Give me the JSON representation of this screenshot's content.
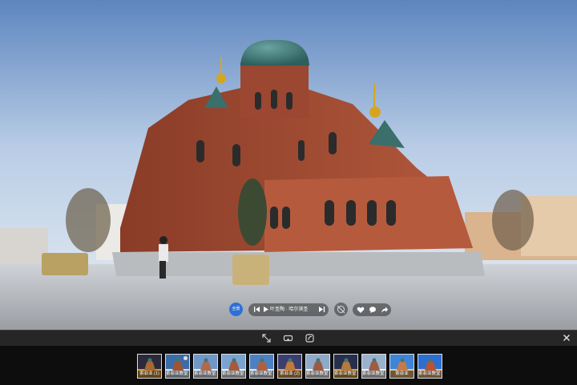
{
  "viewer": {
    "scene_image": "Saint Sophia Cathedral panorama (winter)",
    "avatar_text": "全景"
  },
  "player": {
    "title": "叶圣陶 · 哈尔滨圣"
  },
  "toolbar": {
    "icons": [
      "fullscreen-icon",
      "vr-glasses-icon",
      "gyroscope-icon"
    ],
    "close_icon": "close-icon"
  },
  "thumbnails": [
    {
      "label": "索菲亚 (1)",
      "active": false
    },
    {
      "label": "索菲亚教堂 (2)",
      "active": true
    },
    {
      "label": "索菲亚教堂 (3)",
      "active": false
    },
    {
      "label": "索菲亚教堂 (4)",
      "active": false
    },
    {
      "label": "索菲亚教堂 (5)",
      "active": false
    },
    {
      "label": "索菲亚 (2)",
      "active": false
    },
    {
      "label": "索菲亚教堂 (6)",
      "active": false
    },
    {
      "label": "索菲亚教堂 (7)",
      "active": false
    },
    {
      "label": "索菲亚教堂 (8)",
      "active": false
    },
    {
      "label": "索菲亚",
      "active": false
    },
    {
      "label": "索菲亚教堂 (9)",
      "active": false
    }
  ],
  "colors": {
    "sky": "#dfe9f5",
    "brick": "#a04a32",
    "dome": "#3f7a78",
    "accent": "#2f6fd6"
  }
}
